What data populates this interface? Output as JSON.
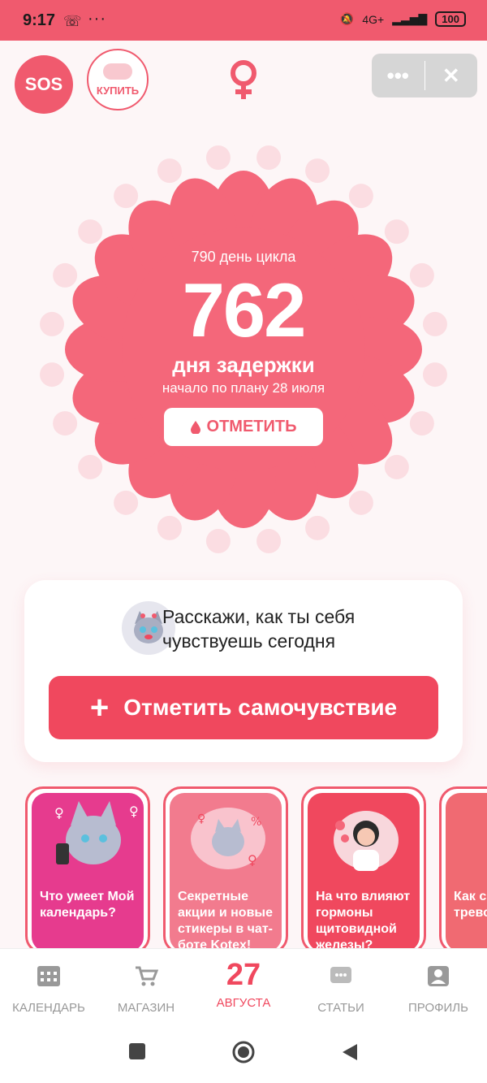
{
  "status_bar": {
    "time": "9:17",
    "dots": "···",
    "network": "4G+",
    "battery": "100"
  },
  "header": {
    "sos_label": "SOS",
    "buy_label": "КУПИТЬ",
    "gender_icon": "venus-icon"
  },
  "cycle": {
    "cycle_day": "790 день цикла",
    "delay_days": "762",
    "delay_label": "дня задержки",
    "planned_start": "начало по плану 28 июля",
    "mark_label": "ОТМЕТИТЬ"
  },
  "mood": {
    "prompt": "Расскажи, как ты себя чувствуешь сегодня",
    "button_label": "Отметить самочувствие"
  },
  "stories": [
    {
      "text": "Что умеет Мой календарь?",
      "color": "#e63b8e"
    },
    {
      "text": "Секретные акции и новые стикеры в чат-боте Kotex!",
      "color": "#f27b8e"
    },
    {
      "text": "На что влияют гормоны щитовидной железы?",
      "color": "#f0485e"
    },
    {
      "text": "Как справ трево Одна",
      "color": "#f06a72"
    }
  ],
  "bottom_nav": {
    "calendar": "КАЛЕНДАРЬ",
    "shop": "МАГАЗИН",
    "date_number": "27",
    "date_month": "АВГУСТА",
    "articles": "СТАТЬИ",
    "profile": "ПРОФИЛЬ"
  },
  "colors": {
    "accent": "#f05a6e",
    "petal": "#f4677a",
    "button": "#f0485e"
  }
}
